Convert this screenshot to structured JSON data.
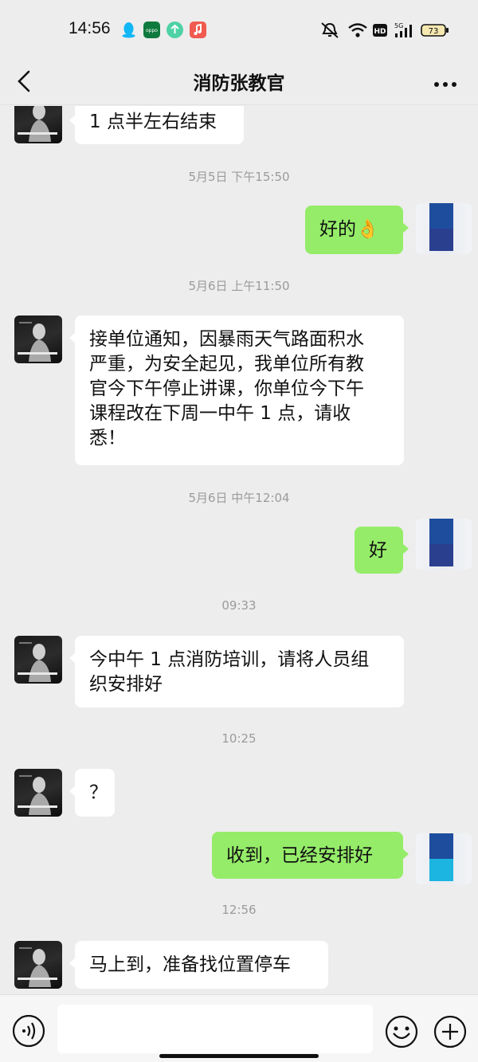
{
  "status_bar": {
    "time": "14:56",
    "app_icons": [
      "qq-icon",
      "oppo-icon",
      "upload-icon",
      "music-icon"
    ],
    "network": "5G",
    "hd": "HD",
    "battery": "73"
  },
  "nav": {
    "title": "消防张教官"
  },
  "messages": [
    {
      "type": "in",
      "text": "1 点半左右结束"
    },
    {
      "type": "time",
      "text": "5月5日 下午15:50"
    },
    {
      "type": "out",
      "text": "好的👌"
    },
    {
      "type": "time",
      "text": "5月6日 上午11:50"
    },
    {
      "type": "in",
      "lines": [
        "接单位通知，因暴雨天气路面积水",
        "严重，为安全起见，我单位所有教",
        "官今下午停止讲课，你单位今下午",
        "课程改在下周一中午 1 点，请收",
        "悉！"
      ]
    },
    {
      "type": "time",
      "text": "5月6日 中午12:04"
    },
    {
      "type": "out",
      "text": "好"
    },
    {
      "type": "time",
      "text": "09:33"
    },
    {
      "type": "in",
      "lines": [
        "今中午 1 点消防培训，请将人员组",
        "织安排好"
      ]
    },
    {
      "type": "time",
      "text": "10:25"
    },
    {
      "type": "in",
      "text": "？"
    },
    {
      "type": "out",
      "text": "收到，已经安排好"
    },
    {
      "type": "time",
      "text": "12:56"
    },
    {
      "type": "in",
      "text": "马上到，准备找位置停车"
    }
  ],
  "colors": {
    "background": "#ededed",
    "outgoing_bubble": "#95ec69",
    "incoming_bubble": "#ffffff",
    "timestamp": "#9b9b9b",
    "self_avatar_top": "#1f4d9e",
    "self_avatar_bottom_last": "#1cb4e0"
  }
}
